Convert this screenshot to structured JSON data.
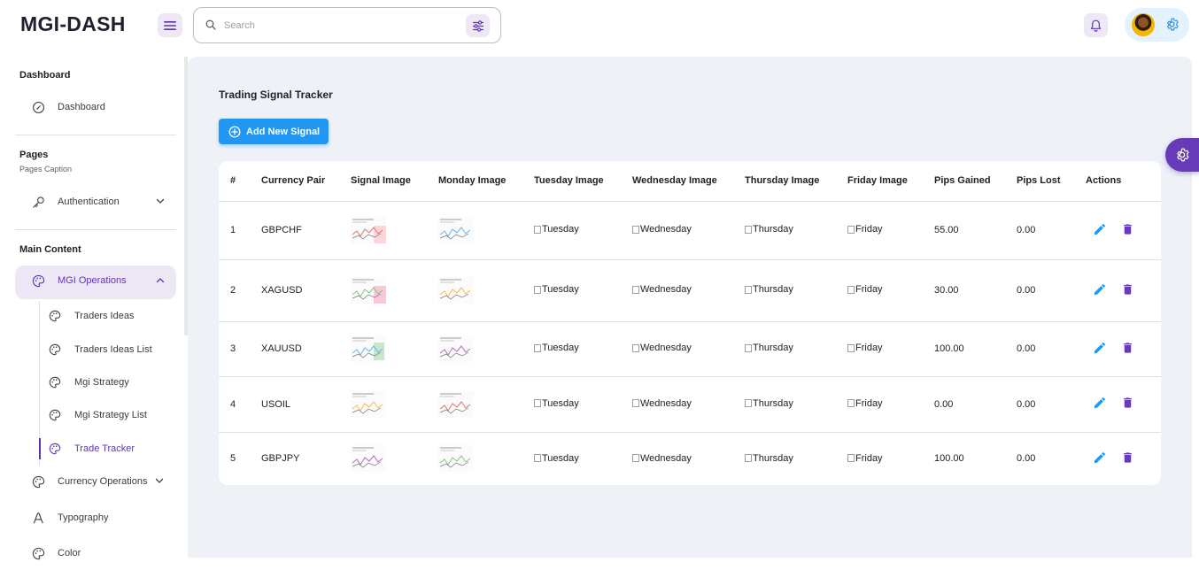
{
  "brand": "MGI-DASH",
  "search": {
    "placeholder": "Search"
  },
  "sidebar": {
    "sections": [
      {
        "title": "Dashboard"
      },
      {
        "title": "Pages",
        "caption": "Pages Caption"
      },
      {
        "title": "Main Content"
      }
    ],
    "items": {
      "dashboard": "Dashboard",
      "authentication": "Authentication",
      "mgi_operations": "MGI Operations",
      "traders_ideas": "Traders Ideas",
      "traders_ideas_list": "Traders Ideas List",
      "mgi_strategy": "Mgi Strategy",
      "mgi_strategy_list": "Mgi Strategy List",
      "trade_tracker": "Trade Tracker",
      "currency_operations": "Currency Operations",
      "typography": "Typography",
      "color": "Color"
    }
  },
  "main": {
    "title": "Trading Signal Tracker",
    "add_button": "Add New Signal",
    "table": {
      "headers": [
        "#",
        "Currency Pair",
        "Signal Image",
        "Monday Image",
        "Tuesday Image",
        "Wednesday Image",
        "Thursday Image",
        "Friday Image",
        "Pips Gained",
        "Pips Lost",
        "Actions"
      ],
      "rows": [
        {
          "num": "1",
          "pair": "GBPCHF",
          "tue": "Tuesday",
          "wed": "Wednesday",
          "thu": "Thursday",
          "fri": "Friday",
          "gained": "55.00",
          "lost": "0.00"
        },
        {
          "num": "2",
          "pair": "XAGUSD",
          "tue": "Tuesday",
          "wed": "Wednesday",
          "thu": "Thursday",
          "fri": "Friday",
          "gained": "30.00",
          "lost": "0.00"
        },
        {
          "num": "3",
          "pair": "XAUUSD",
          "tue": "Tuesday",
          "wed": "Wednesday",
          "thu": "Thursday",
          "fri": "Friday",
          "gained": "100.00",
          "lost": "0.00"
        },
        {
          "num": "4",
          "pair": "USOIL",
          "tue": "Tuesday",
          "wed": "Wednesday",
          "thu": "Thursday",
          "fri": "Friday",
          "gained": "0.00",
          "lost": "0.00"
        },
        {
          "num": "5",
          "pair": "GBPJPY",
          "tue": "Tuesday",
          "wed": "Wednesday",
          "thu": "Thursday",
          "fri": "Friday",
          "gained": "100.00",
          "lost": "0.00"
        }
      ]
    }
  },
  "icons": {
    "menu": "menu-icon",
    "search": "search-icon",
    "tune": "tune-icon",
    "bell": "bell-icon",
    "settings": "gear-icon",
    "edit": "pencil-icon",
    "delete": "trash-icon"
  },
  "colors": {
    "primary": "#2196f3",
    "secondary": "#673ab7",
    "secondary_light": "#ede7f6",
    "background": "#eef2f6"
  }
}
